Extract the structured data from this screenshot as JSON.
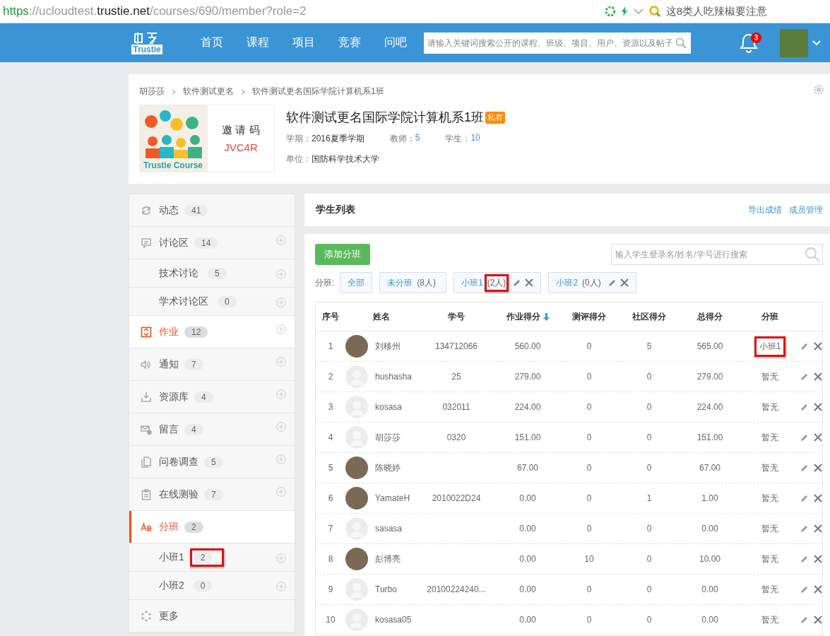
{
  "browser": {
    "url_parts": [
      {
        "text": "https",
        "kind": "scheme"
      },
      {
        "text": "://ucloudtest.",
        "kind": "plain"
      },
      {
        "text": "trustie.net",
        "kind": "host"
      },
      {
        "text": "/courses/690/member?role=2",
        "kind": "plain"
      }
    ],
    "news": "这8类人吃辣椒要注意"
  },
  "nav": {
    "logo_text": "Trustie",
    "links": [
      "首页",
      "课程",
      "项目",
      "竞赛",
      "问吧"
    ],
    "search": {
      "placeholder": "请输入关键词搜索公开的课程、班级、项目、用户、资源以及帖子"
    },
    "notifications": "3"
  },
  "course": {
    "breadcrumb": [
      "胡莎莎",
      "软件测试更名",
      "软件测试更名国际学院计算机系1班"
    ],
    "image_caption": "Trustie Course",
    "invite_label": "邀 请 码",
    "invite_code": "JVC4R",
    "title": "软件测试更名国际学院计算机系1班",
    "badge": "私有",
    "meta": [
      {
        "label": "学期：",
        "value": "2016夏季学期",
        "link": false
      },
      {
        "label": "教师：",
        "value": "5",
        "link": true
      },
      {
        "label": "学生：",
        "value": "10",
        "link": true
      }
    ],
    "unit_label": "单位：",
    "unit": "国防科学技术大学"
  },
  "sidebar": {
    "items": [
      {
        "kind": "refresh",
        "label": "动态",
        "count": "41",
        "current": false,
        "selected": false,
        "addable": false
      },
      {
        "kind": "comment",
        "label": "讨论区",
        "count": "14",
        "current": false,
        "selected": false,
        "addable": true,
        "children": [
          {
            "label": "技术讨论",
            "count": "5",
            "highlighted": false
          },
          {
            "label": "学术讨论区",
            "count": "0",
            "highlighted": false
          }
        ]
      },
      {
        "kind": "homework",
        "label": "作业",
        "count": "12",
        "current": true,
        "selected": false,
        "addable": true
      },
      {
        "kind": "speaker",
        "label": "通知",
        "count": "7",
        "current": false,
        "selected": false,
        "addable": true
      },
      {
        "kind": "download",
        "label": "资源库",
        "count": "4",
        "current": false,
        "selected": false,
        "addable": true
      },
      {
        "kind": "mail",
        "label": "留言",
        "count": "4",
        "current": false,
        "selected": false,
        "addable": true
      },
      {
        "kind": "documents",
        "label": "问卷调查",
        "count": "5",
        "current": false,
        "selected": false,
        "addable": true
      },
      {
        "kind": "clipboard",
        "label": "在线测验",
        "count": "7",
        "current": false,
        "selected": false,
        "addable": true
      },
      {
        "kind": "letters",
        "label": "分班",
        "count": "2",
        "current": true,
        "selected": true,
        "addable": false,
        "children": [
          {
            "label": "小班1",
            "count": "2",
            "highlighted": true
          },
          {
            "label": "小班2",
            "count": "0",
            "highlighted": false
          }
        ]
      },
      {
        "kind": "dots",
        "label": "更多",
        "current": false,
        "selected": false,
        "addable": false
      }
    ]
  },
  "panel": {
    "title": "学生列表",
    "links": [
      "导出成绩",
      "成员管理"
    ],
    "add_button": "添加分班",
    "search": {
      "placeholder": "输入学生登录名/姓名/学号进行搜索"
    },
    "filter_label": "分班:",
    "filters": [
      {
        "label": "全部",
        "editable": false,
        "highlighted": false
      },
      {
        "label": "未分班",
        "count": "(8人)",
        "editable": false,
        "highlighted": false
      },
      {
        "label": "小班1",
        "count": "(2人)",
        "editable": true,
        "highlighted": true
      },
      {
        "label": "小班2",
        "count": "(0人)",
        "editable": true,
        "highlighted": false
      }
    ]
  },
  "table": {
    "columns": [
      {
        "label": "序号",
        "sorted": false
      },
      {
        "label": "姓名",
        "sorted": false
      },
      {
        "label": "学号",
        "sorted": false
      },
      {
        "label": "作业得分",
        "sorted": true
      },
      {
        "label": "测评得分",
        "sorted": false
      },
      {
        "label": "社区得分",
        "sorted": false
      },
      {
        "label": "总得分",
        "sorted": false
      },
      {
        "label": "分班",
        "sorted": false
      }
    ],
    "rows": [
      {
        "no": "1",
        "kind": "photo",
        "name": "刘移州",
        "id": "134712066",
        "homework": "560.00",
        "test": "0",
        "community": "5",
        "total": "565.00",
        "group": "小班1",
        "highlighted": true
      },
      {
        "no": "2",
        "kind": "default",
        "name": "hushasha",
        "id": "25",
        "homework": "279.00",
        "test": "0",
        "community": "0",
        "total": "279.00",
        "group": "暂无",
        "highlighted": false
      },
      {
        "no": "3",
        "kind": "default",
        "name": "kosasa",
        "id": "032011",
        "homework": "224.00",
        "test": "0",
        "community": "0",
        "total": "224.00",
        "group": "暂无",
        "highlighted": false
      },
      {
        "no": "4",
        "kind": "default",
        "name": "胡莎莎",
        "id": "0320",
        "homework": "151.00",
        "test": "0",
        "community": "0",
        "total": "151.00",
        "group": "暂无",
        "highlighted": false
      },
      {
        "no": "5",
        "kind": "photo",
        "name": "陈晓婷",
        "homework": "67.00",
        "test": "0",
        "community": "0",
        "total": "67.00",
        "group": "暂无",
        "highlighted": false
      },
      {
        "no": "6",
        "kind": "photo",
        "name": "YamateH",
        "id": "2010022D24",
        "homework": "0.00",
        "test": "0",
        "community": "1",
        "total": "1.00",
        "group": "暂无",
        "highlighted": false
      },
      {
        "no": "7",
        "kind": "default",
        "name": "sasasa",
        "homework": "0.00",
        "test": "0",
        "community": "0",
        "total": "0.00",
        "group": "暂无",
        "highlighted": false
      },
      {
        "no": "8",
        "kind": "photo",
        "name": "彭博亮",
        "homework": "0.00",
        "test": "10",
        "community": "0",
        "total": "10.00",
        "group": "暂无",
        "highlighted": false
      },
      {
        "no": "9",
        "kind": "default",
        "name": "Turbo",
        "id": "20100224240...",
        "homework": "0.00",
        "test": "0",
        "community": "0",
        "total": "0.00",
        "group": "暂无",
        "highlighted": false
      },
      {
        "no": "10",
        "kind": "default",
        "name": "kosasa05",
        "homework": "0.00",
        "test": "0",
        "community": "0",
        "total": "0.00",
        "group": "暂无",
        "highlighted": false
      }
    ]
  }
}
